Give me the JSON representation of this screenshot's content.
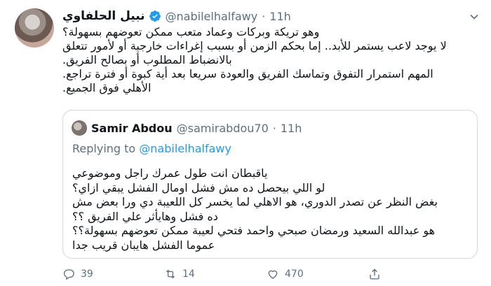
{
  "tweet": {
    "display_name": "نبيل الحلفاوي",
    "handle": "@nabilelhalfawy",
    "dot": "·",
    "time": "11h",
    "lines": [
      "وهو تريكة وبركات وعماد متعب ممكن تعوضهم بسهولة؟",
      "لا يوجد لاعب يستمر للأبد.. إما بحكم الزمن أو بسبب إغراءات خارجية أو لأمور تتعلق",
      "بالانضباط المطلوب أو بصالح الفريق.",
      "المهم استمرار التفوق وتماسك الفريق والعودة سريعا بعد أية كبوة أو فترة تراجع.",
      "الأهلي فوق الجميع."
    ]
  },
  "quote": {
    "name": "Samir Abdou",
    "handle": "@samirabdou70",
    "dot": "·",
    "time": "11h",
    "replying_prefix": "Replying to",
    "replying_mention": "@nabilelhalfawy",
    "lines": [
      "ياقبطان انت طول عمرك راجل  وموضوعي",
      "لو اللي بيحصل ده مش فشل اومال الفشل يبقي ازاي؟",
      "بغض النظر عن تصدر الدوري، هو الاهلي لما يخسر كل اللعيبة دي ورا بعض مش",
      "ده فشل وهايأثر علي الفريق ؟؟",
      "هو عبدالله السعيد ورمضان صبحي واحمد فتحي لعيبة ممكن تعوضهم بسهولة؟؟",
      "عموما الفشل هايبان قريب جدا"
    ]
  },
  "actions": {
    "replies": "39",
    "retweets": "14",
    "likes": "470"
  },
  "colors": {
    "accent": "#1d9bf0",
    "muted": "#5b7083",
    "border": "#cfd9de"
  }
}
